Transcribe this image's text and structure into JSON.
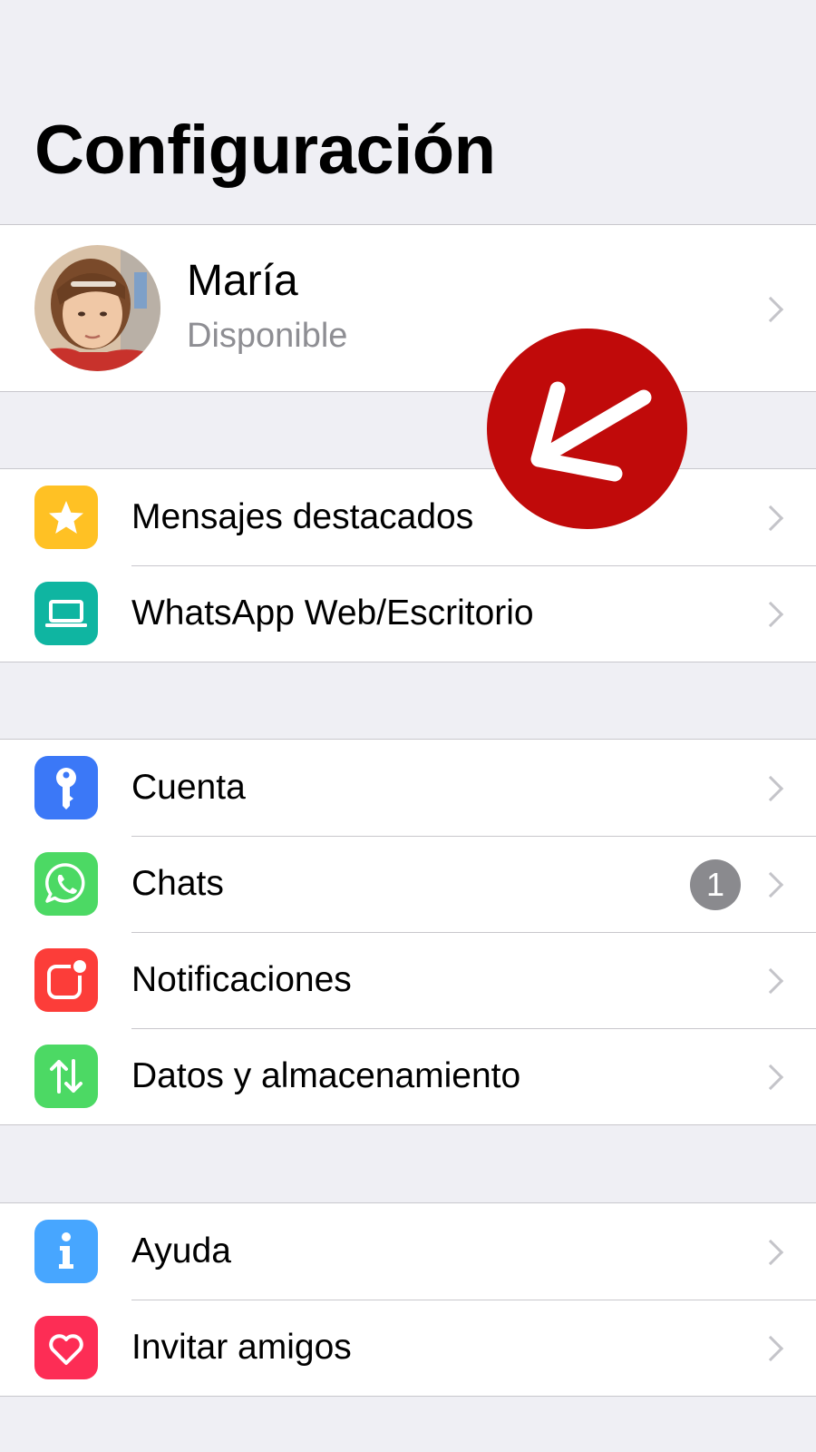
{
  "header": {
    "title": "Configuración"
  },
  "profile": {
    "name": "María",
    "status": "Disponible",
    "avatar_icon": "profile-photo-icon"
  },
  "sections": [
    {
      "items": [
        {
          "label": "Mensajes destacados",
          "icon": "star-icon",
          "icon_color": "#ffc124"
        },
        {
          "label": "WhatsApp Web/Escritorio",
          "icon": "laptop-icon",
          "icon_color": "#0fb5a1"
        }
      ]
    },
    {
      "items": [
        {
          "label": "Cuenta",
          "icon": "key-icon",
          "icon_color": "#3b78f7"
        },
        {
          "label": "Chats",
          "icon": "whatsapp-icon",
          "icon_color": "#4cd964",
          "badge": "1"
        },
        {
          "label": "Notificaciones",
          "icon": "notification-icon",
          "icon_color": "#fc3d39"
        },
        {
          "label": "Datos y almacenamiento",
          "icon": "data-arrows-icon",
          "icon_color": "#4cd964"
        }
      ]
    },
    {
      "items": [
        {
          "label": "Ayuda",
          "icon": "info-icon",
          "icon_color": "#47a6ff"
        },
        {
          "label": "Invitar amigos",
          "icon": "heart-icon",
          "icon_color": "#fd2d55"
        }
      ]
    }
  ],
  "overlay": {
    "icon": "red-pointer-arrow-icon",
    "color": "#c00a0a"
  }
}
